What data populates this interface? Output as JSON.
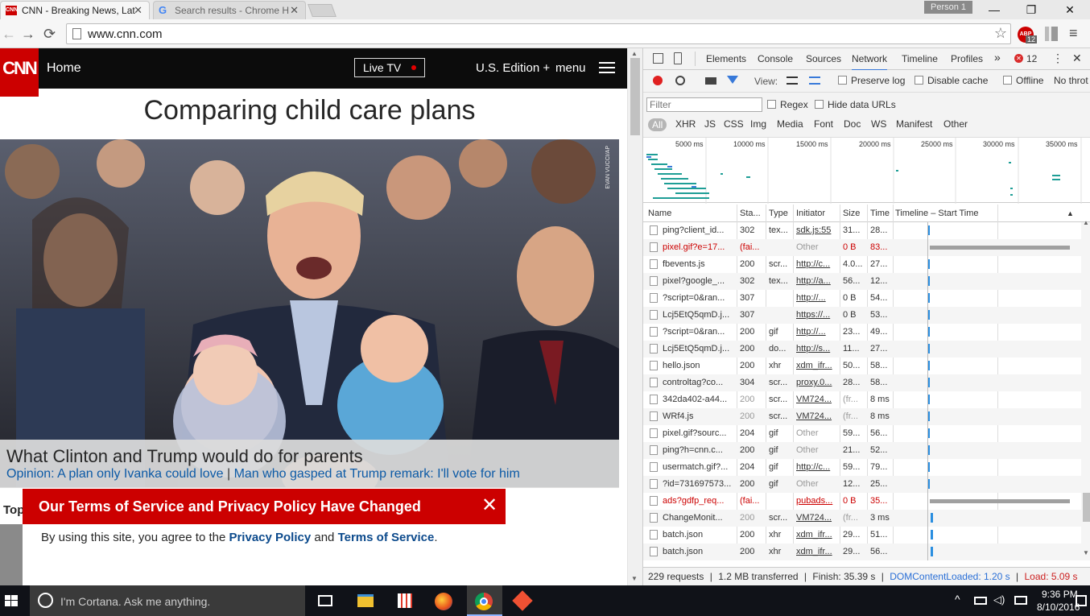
{
  "browser": {
    "tabs": [
      {
        "title": "CNN - Breaking News, Lat",
        "active": true
      },
      {
        "title": "Search results - Chrome H",
        "active": false
      }
    ],
    "profile": "Person 1",
    "url": "www.cnn.com",
    "abp_badge": "12"
  },
  "cnn": {
    "logo": "CNN",
    "nav_home": "Home",
    "live_tv": "Live TV",
    "edition": "U.S. Edition +",
    "menu": "menu",
    "headline": "Comparing child care plans",
    "photo_credit": "EVAN VUCCI/AP",
    "caption_title": "What Clinton and Trump would do for parents",
    "caption_link1": "Opinion: A plan only Ivanka could love",
    "caption_sep": "|",
    "caption_link2": "Man who gasped at Trump remark: I'll vote for him",
    "top_partial": "Top",
    "modal_title": "Our Terms of Service and Privacy Policy Have Changed",
    "modal_text_before": "By using this site, you agree to the ",
    "modal_link1": "Privacy Policy",
    "modal_and": " and ",
    "modal_link2": "Terms of Service",
    "modal_end": "."
  },
  "devtools": {
    "tabs": [
      "Elements",
      "Console",
      "Sources",
      "Network",
      "Timeline",
      "Profiles"
    ],
    "selected_tab": "Network",
    "more": "»",
    "error_count": "12",
    "view_label": "View:",
    "preserve_log": "Preserve log",
    "disable_cache": "Disable cache",
    "offline": "Offline",
    "no_throttle": "No throt",
    "filter_placeholder": "Filter",
    "regex": "Regex",
    "hide_data_urls": "Hide data URLs",
    "types": [
      "All",
      "XHR",
      "JS",
      "CSS",
      "Img",
      "Media",
      "Font",
      "Doc",
      "WS",
      "Manifest",
      "Other"
    ],
    "overview_ticks": [
      "5000 ms",
      "10000 ms",
      "15000 ms",
      "20000 ms",
      "25000 ms",
      "30000 ms",
      "35000 ms"
    ],
    "columns": [
      "Name",
      "Sta...",
      "Type",
      "Initiator",
      "Size",
      "Time",
      "Timeline – Start Time"
    ],
    "rows": [
      {
        "name": "ping?client_id...",
        "status": "302",
        "type": "tex...",
        "initiator": "sdk.js:55",
        "size": "31...",
        "time": "28...",
        "state": "ok",
        "bar": 0.02
      },
      {
        "name": "pixel.gif?e=17...",
        "status": "(fai...",
        "type": "",
        "initiator": "Other",
        "size": "0 B",
        "time": "83...",
        "state": "fail",
        "bar": 0.02
      },
      {
        "name": "fbevents.js",
        "status": "200",
        "type": "scr...",
        "initiator": "http://c...",
        "size": "4.0...",
        "time": "27...",
        "state": "ok",
        "bar": 0.02
      },
      {
        "name": "pixel?google_...",
        "status": "302",
        "type": "tex...",
        "initiator": "http://a...",
        "size": "56...",
        "time": "12...",
        "state": "ok",
        "bar": 0.02
      },
      {
        "name": "?script=0&ran...",
        "status": "307",
        "type": "",
        "initiator": "http://...",
        "size": "0 B",
        "time": "54...",
        "state": "ok",
        "bar": 0.02
      },
      {
        "name": "Lcj5EtQ5qmD.j...",
        "status": "307",
        "type": "",
        "initiator": "https://...",
        "size": "0 B",
        "time": "53...",
        "state": "ok",
        "bar": 0.02
      },
      {
        "name": "?script=0&ran...",
        "status": "200",
        "type": "gif",
        "initiator": "http://...",
        "size": "23...",
        "time": "49...",
        "state": "ok",
        "bar": 0.02
      },
      {
        "name": "Lcj5EtQ5qmD.j...",
        "status": "200",
        "type": "do...",
        "initiator": "http://s...",
        "size": "11...",
        "time": "27...",
        "state": "ok",
        "bar": 0.02
      },
      {
        "name": "hello.json",
        "status": "200",
        "type": "xhr",
        "initiator": "xdm_ifr...",
        "size": "50...",
        "time": "58...",
        "state": "ok",
        "bar": 0.02
      },
      {
        "name": "controltag?co...",
        "status": "304",
        "type": "scr...",
        "initiator": "proxy.0...",
        "size": "28...",
        "time": "58...",
        "state": "ok",
        "bar": 0.02
      },
      {
        "name": "342da402-a44...",
        "status": "200",
        "type": "scr...",
        "initiator": "VM724...",
        "size": "(fr...",
        "time": "8 ms",
        "state": "dim",
        "bar": 0.02
      },
      {
        "name": "WRf4.js",
        "status": "200",
        "type": "scr...",
        "initiator": "VM724...",
        "size": "(fr...",
        "time": "8 ms",
        "state": "dim",
        "bar": 0.02
      },
      {
        "name": "pixel.gif?sourc...",
        "status": "204",
        "type": "gif",
        "initiator": "Other",
        "size": "59...",
        "time": "56...",
        "state": "ok",
        "bar": 0.02
      },
      {
        "name": "ping?h=cnn.c...",
        "status": "200",
        "type": "gif",
        "initiator": "Other",
        "size": "21...",
        "time": "52...",
        "state": "ok",
        "bar": 0.02
      },
      {
        "name": "usermatch.gif?...",
        "status": "204",
        "type": "gif",
        "initiator": "http://c...",
        "size": "59...",
        "time": "79...",
        "state": "ok",
        "bar": 0.02
      },
      {
        "name": "?id=731697573...",
        "status": "200",
        "type": "gif",
        "initiator": "Other",
        "size": "12...",
        "time": "25...",
        "state": "ok",
        "bar": 0.02
      },
      {
        "name": "ads?gdfp_req...",
        "status": "(fai...",
        "type": "",
        "initiator": "pubads...",
        "size": "0 B",
        "time": "35...",
        "state": "fail",
        "bar": 0.02
      },
      {
        "name": "ChangeMonit...",
        "status": "200",
        "type": "scr...",
        "initiator": "VM724...",
        "size": "(fr...",
        "time": "3 ms",
        "state": "dim",
        "bar": 0.02
      },
      {
        "name": "batch.json",
        "status": "200",
        "type": "xhr",
        "initiator": "xdm_ifr...",
        "size": "29...",
        "time": "51...",
        "state": "ok",
        "bar": 0.02
      },
      {
        "name": "batch.json",
        "status": "200",
        "type": "xhr",
        "initiator": "xdm_ifr...",
        "size": "29...",
        "time": "56...",
        "state": "ok",
        "bar": 0.02
      }
    ],
    "status_requests": "229 requests",
    "status_transferred": "1.2 MB transferred",
    "status_finish": "Finish: 35.39 s",
    "status_dom": "DOMContentLoaded: 1.20 s",
    "status_load": "Load: 5.09 s",
    "sep": "|"
  },
  "taskbar": {
    "cortana_placeholder": "I'm Cortana. Ask me anything.",
    "time": "9:36 PM",
    "date": "8/10/2016"
  },
  "colors": {
    "cnn_red": "#cc0000",
    "cnn_link_blue": "#0c4a8c",
    "devtools_blue": "#3879d9",
    "fail_red": "#cc0000"
  }
}
